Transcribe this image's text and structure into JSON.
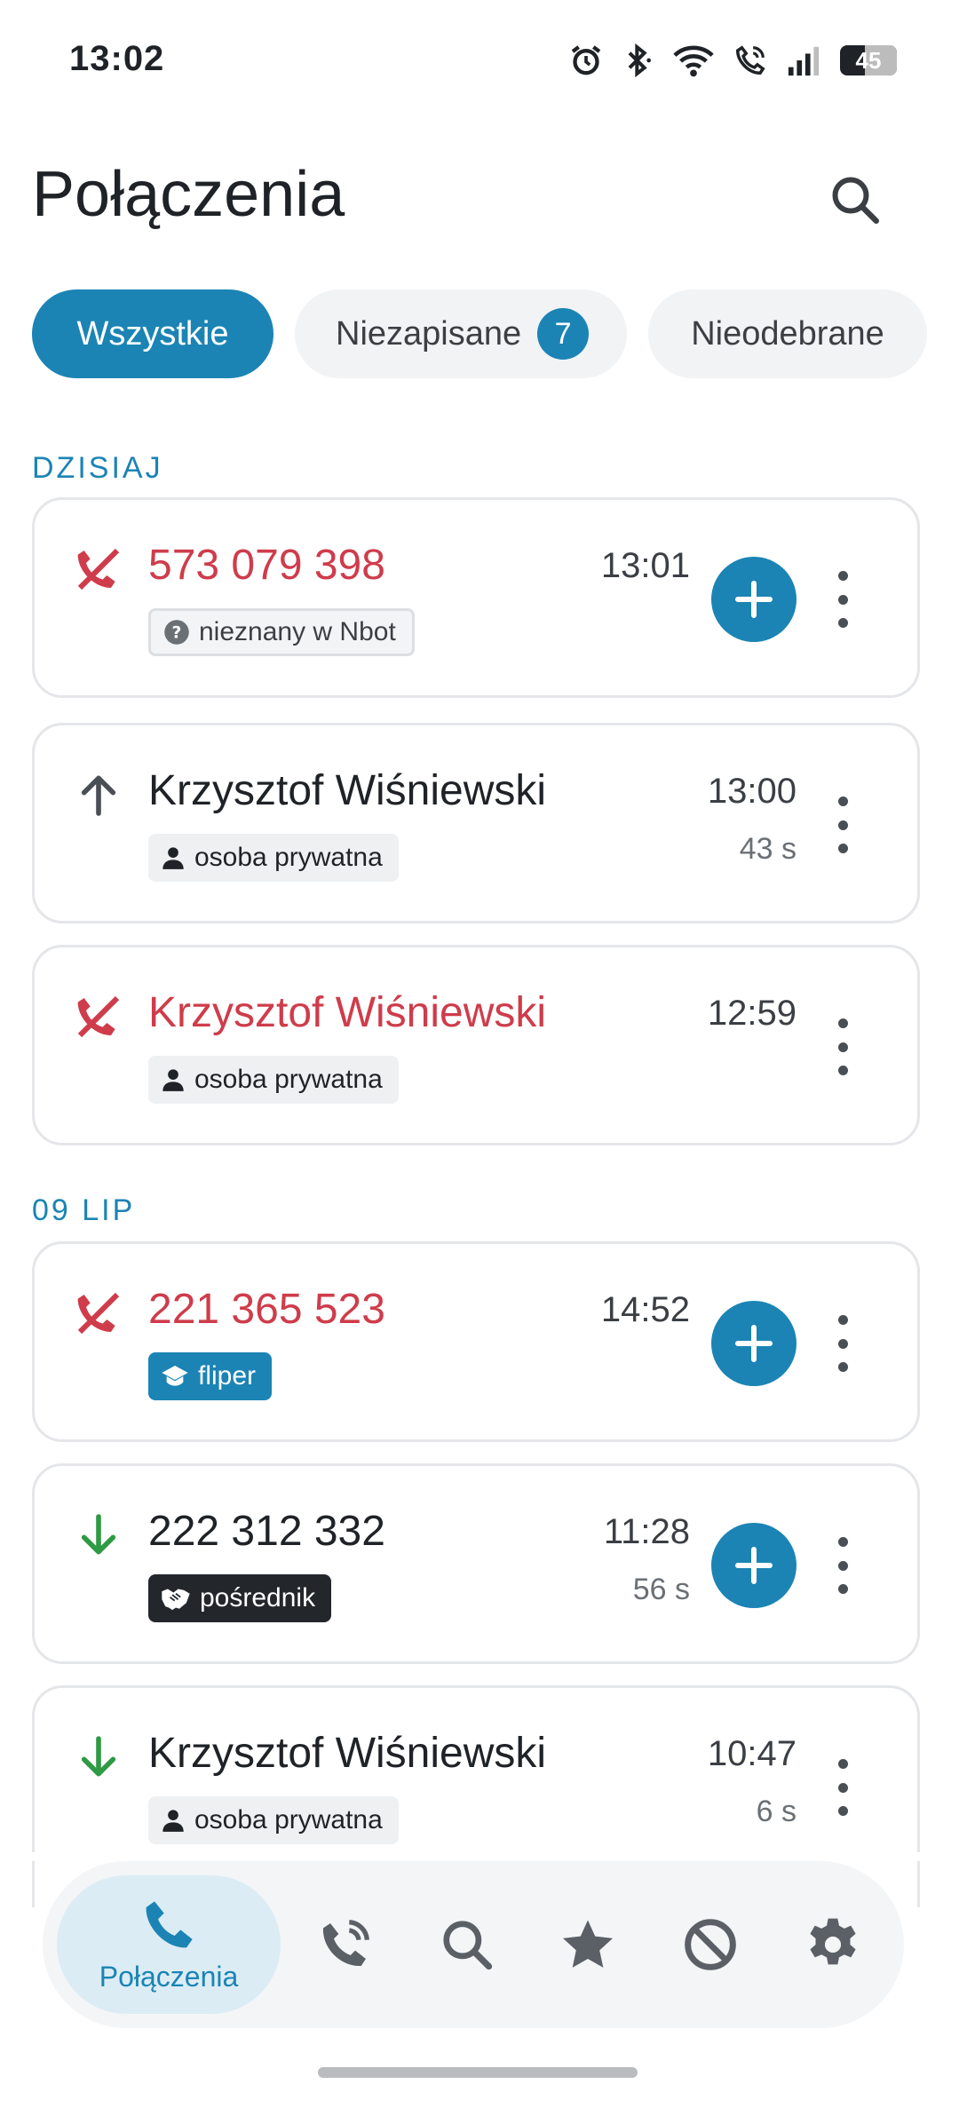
{
  "status_bar": {
    "time": "13:02",
    "battery": "45"
  },
  "header": {
    "title": "Połączenia"
  },
  "filters": [
    {
      "label": "Wszystkie",
      "active": true
    },
    {
      "label": "Niezapisane",
      "badge": "7"
    },
    {
      "label": "Nieodebrane"
    }
  ],
  "sections": [
    {
      "label": "DZISIAJ",
      "calls": [
        {
          "name": "573 079 398",
          "type": "missed",
          "tag": "nieznany w Nbot",
          "time": "13:01",
          "duration": "",
          "add": true
        },
        {
          "name": "Krzysztof Wiśniewski",
          "type": "outgoing",
          "tag": "osoba prywatna",
          "time": "13:00",
          "duration": "43 s",
          "add": false
        },
        {
          "name": "Krzysztof Wiśniewski",
          "type": "missed",
          "tag": "osoba prywatna",
          "time": "12:59",
          "duration": "",
          "add": false
        }
      ]
    },
    {
      "label": "09 LIP",
      "calls": [
        {
          "name": "221 365 523",
          "type": "missed",
          "tag": "fliper",
          "time": "14:52",
          "duration": "",
          "add": true
        },
        {
          "name": "222 312 332",
          "type": "incoming",
          "tag": "pośrednik",
          "time": "11:28",
          "duration": "56 s",
          "add": true
        },
        {
          "name": "Krzysztof Wiśniewski",
          "type": "incoming",
          "tag": "osoba prywatna",
          "time": "10:47",
          "duration": "6 s",
          "add": false
        }
      ]
    }
  ],
  "bottom_nav": {
    "active_label": "Połączenia",
    "items": [
      "phone-icon",
      "phone-ringing-icon",
      "search-icon",
      "star-icon",
      "block-icon",
      "gear-icon"
    ]
  },
  "colors": {
    "accent": "#1b84b4",
    "missed": "#cf3c4b",
    "incoming": "#2e9a44",
    "text": "#1f2226"
  }
}
